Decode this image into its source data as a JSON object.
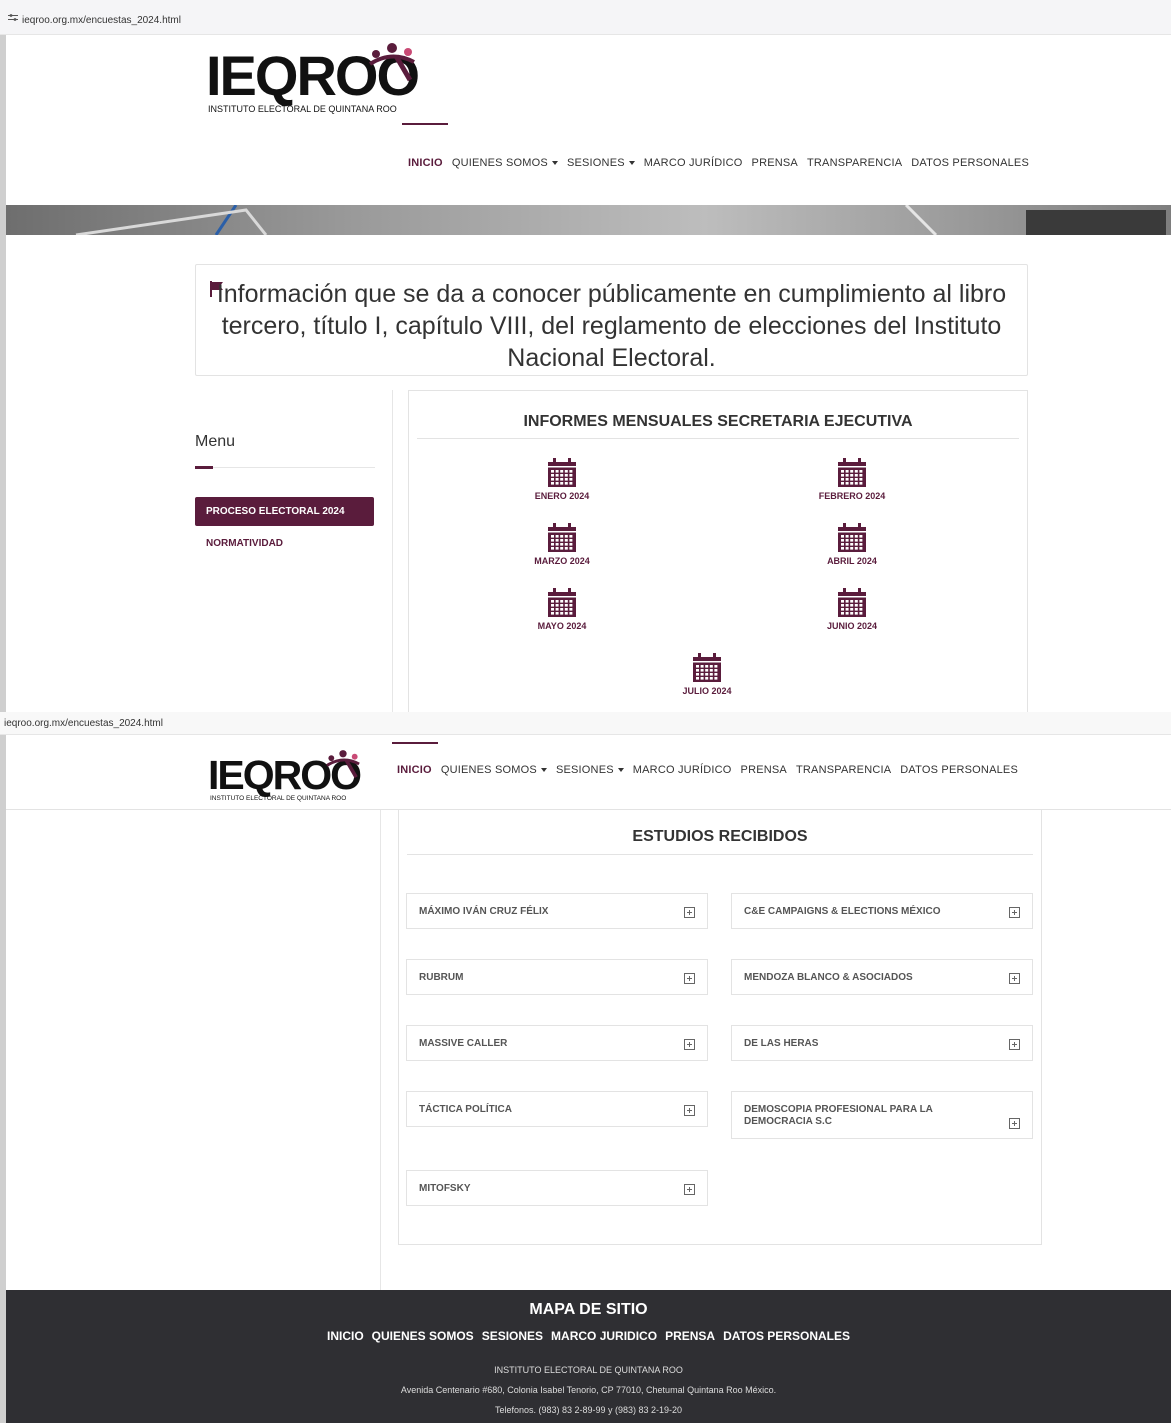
{
  "browser": {
    "url_top": "ieqroo.org.mx/encuestas_2024.html",
    "url_bottom": "ieqroo.org.mx/encuestas_2024.html"
  },
  "logo": {
    "word": "IEQROO",
    "subtitle": "INSTITUTO ELECTORAL DE QUINTANA ROO"
  },
  "nav": {
    "items": [
      "INICIO",
      "QUIENES SOMOS",
      "SESIONES",
      "MARCO JURÍDICO",
      "PRENSA",
      "TRANSPARENCIA",
      "DATOS PERSONALES"
    ]
  },
  "notice": {
    "text": "Información que se da a conocer públicamente en cumplimiento al libro tercero, título I, capítulo VIII, del reglamento de elecciones del Instituto Nacional Electoral."
  },
  "sidebar": {
    "title": "Menu",
    "items": [
      "PROCESO ELECTORAL 2024",
      "NORMATIVIDAD"
    ]
  },
  "informes": {
    "title": "INFORMES MENSUALES SECRETARIA EJECUTIVA",
    "months": [
      "ENERO 2024",
      "FEBRERO 2024",
      "MARZO 2024",
      "ABRIL 2024",
      "MAYO 2024",
      "JUNIO 2024",
      "JULIO 2024"
    ]
  },
  "estudios": {
    "title": "ESTUDIOS RECIBIDOS",
    "items": [
      "MÁXIMO IVÁN CRUZ FÉLIX",
      "C&E CAMPAIGNS & ELECTIONS MÉXICO",
      "RUBRUM",
      "MENDOZA BLANCO & ASOCIADOS",
      "MASSIVE CALLER",
      "DE LAS HERAS",
      "TÁCTICA POLÍTICA",
      "DEMOSCOPIA PROFESIONAL PARA LA DEMOCRACIA S.C",
      "MITOFSKY"
    ]
  },
  "footer": {
    "title": "MAPA DE SITIO",
    "links": [
      "INICIO",
      "QUIENES SOMOS",
      "SESIONES",
      "MARCO JURIDICO",
      "PRENSA",
      "DATOS PERSONALES"
    ],
    "org": "INSTITUTO ELECTORAL DE QUINTANA ROO",
    "address": "Avenida Centenario #680, Colonia Isabel Tenorio, CP 77010, Chetumal Quintana Roo México.",
    "phones": "Telefonos. (983) 83 2-89-99 y (983) 83 2-19-20"
  },
  "colors": {
    "brand": "#5a1c3c",
    "footer_bg": "#2f2f33"
  }
}
